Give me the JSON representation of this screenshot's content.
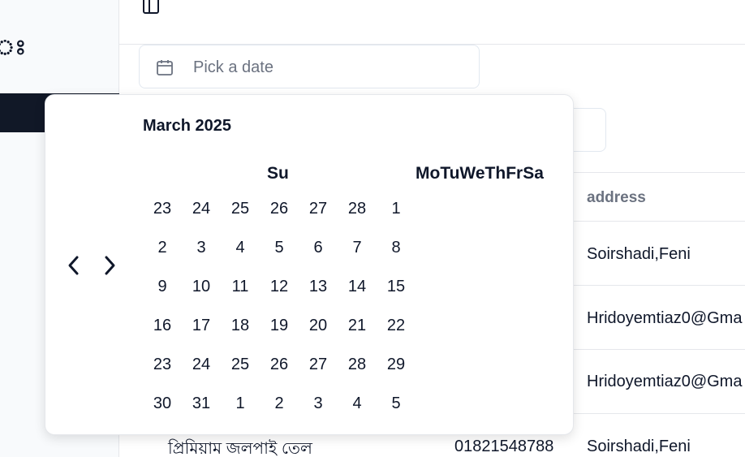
{
  "sidebar": {
    "logo_glyph": "ঃ"
  },
  "date_picker": {
    "placeholder": "Pick a date",
    "month_label": "March 2025",
    "weekday_first": "Su",
    "weekday_rest": "MoTuWeThFrSa",
    "days": [
      "23",
      "24",
      "25",
      "26",
      "27",
      "28",
      "1",
      "2",
      "3",
      "4",
      "5",
      "6",
      "7",
      "8",
      "9",
      "10",
      "11",
      "12",
      "13",
      "14",
      "15",
      "16",
      "17",
      "18",
      "19",
      "20",
      "21",
      "22",
      "23",
      "24",
      "25",
      "26",
      "27",
      "28",
      "29",
      "30",
      "31",
      "1",
      "2",
      "3",
      "4",
      "5"
    ],
    "icons": {
      "calendar": "calendar-icon",
      "prev": "chevron-left-icon",
      "next": "chevron-right-icon"
    }
  },
  "table": {
    "address_header": "address",
    "rows": [
      {
        "address": "Soirshadi,Feni"
      },
      {
        "address": "Hridoyemtiaz0@Gma"
      },
      {
        "address": "Hridoyemtiaz0@Gma"
      },
      {
        "name": "প্রিমিয়াম জলপাই তেল",
        "phone": "01821548788",
        "address": "Soirshadi,Feni"
      }
    ]
  }
}
